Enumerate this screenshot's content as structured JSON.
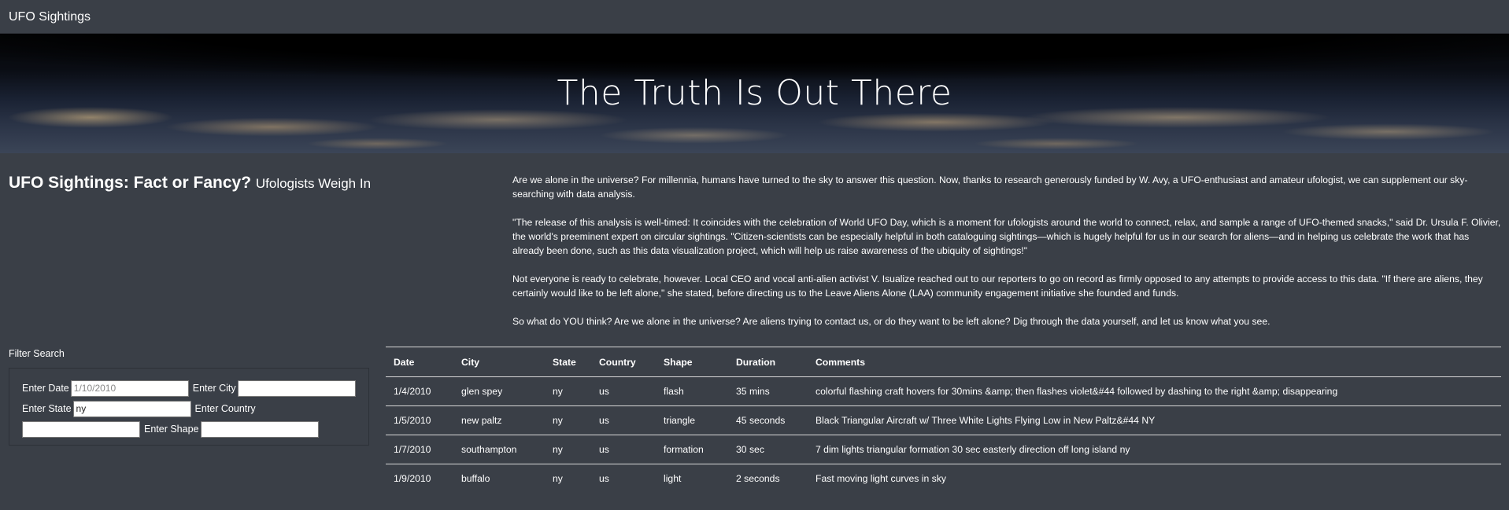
{
  "navbar": {
    "brand": "UFO Sightings"
  },
  "hero": {
    "title": "The Truth Is Out There"
  },
  "heading": {
    "main": "UFO Sightings: Fact or Fancy?",
    "sub": "Ufologists Weigh In"
  },
  "article": {
    "paragraphs": [
      "Are we alone in the universe? For millennia, humans have turned to the sky to answer this question. Now, thanks to research generously funded by W. Avy, a UFO-enthusiast and amateur ufologist, we can supplement our sky-searching with data analysis.",
      "\"The release of this analysis is well-timed: It coincides with the celebration of World UFO Day, which is a moment for ufologists around the world to connect, relax, and sample a range of UFO-themed snacks,\" said Dr. Ursula F. Olivier, the world's preeminent expert on circular sightings. \"Citizen-scientists can be especially helpful in both cataloguing sightings—which is hugely helpful for us in our search for aliens—and in helping us celebrate the work that has already been done, such as this data visualization project, which will help us raise awareness of the ubiquity of sightings!\"",
      "Not everyone is ready to celebrate, however. Local CEO and vocal anti-alien activist V. Isualize reached out to our reporters to go on record as firmly opposed to any attempts to provide access to this data. \"If there are aliens, they certainly would like to be left alone,\" she stated, before directing us to the Leave Aliens Alone (LAA) community engagement initiative she founded and funds.",
      "So what do YOU think? Are we alone in the universe? Are aliens trying to contact us, or do they want to be left alone? Dig through the data yourself, and let us know what you see."
    ]
  },
  "filter": {
    "title": "Filter Search",
    "date": {
      "label": "Enter Date",
      "placeholder": "1/10/2010",
      "value": ""
    },
    "city": {
      "label": "Enter City",
      "placeholder": "",
      "value": ""
    },
    "state": {
      "label": "Enter State",
      "placeholder": "",
      "value": "ny"
    },
    "country": {
      "label": "Enter Country",
      "placeholder": "",
      "value": ""
    },
    "shape": {
      "label": "Enter Shape",
      "placeholder": "",
      "value": ""
    }
  },
  "table": {
    "headers": [
      "Date",
      "City",
      "State",
      "Country",
      "Shape",
      "Duration",
      "Comments"
    ],
    "rows": [
      [
        "1/4/2010",
        "glen spey",
        "ny",
        "us",
        "flash",
        "35 mins",
        "colorful flashing craft hovers for 30mins &amp; then flashes violet&#44 followed by dashing to the right &amp; disappearing"
      ],
      [
        "1/5/2010",
        "new paltz",
        "ny",
        "us",
        "triangle",
        "45 seconds",
        "Black Triangular Aircraft w/ Three White Lights Flying Low in New Paltz&#44 NY"
      ],
      [
        "1/7/2010",
        "southampton",
        "ny",
        "us",
        "formation",
        "30 sec",
        "7 dim lights triangular formation 30 sec easterly direction off long island ny"
      ],
      [
        "1/9/2010",
        "buffalo",
        "ny",
        "us",
        "light",
        "2 seconds",
        "Fast moving light curves in sky"
      ]
    ]
  }
}
